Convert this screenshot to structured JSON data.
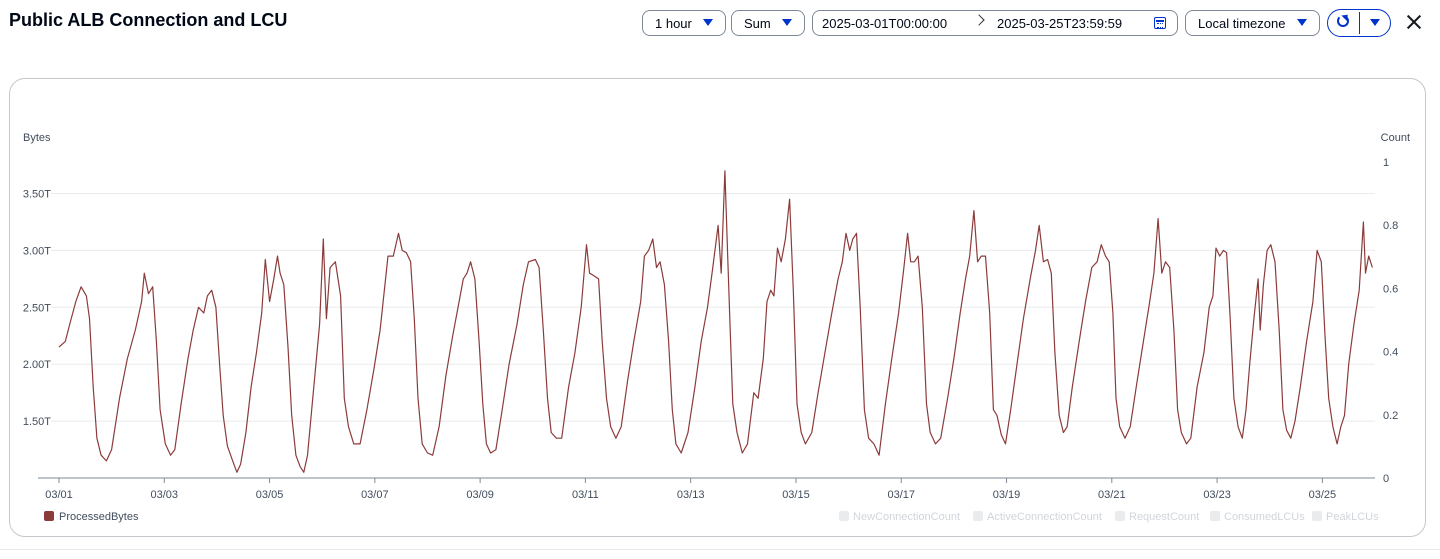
{
  "title": "Public ALB Connection and LCU",
  "controls": {
    "period": "1 hour",
    "statistic": "Sum",
    "range_start": "2025-03-01T00:00:00",
    "range_end": "2025-03-25T23:59:59",
    "timezone": "Local timezone"
  },
  "icons": [
    "caret-down-icon",
    "chevron-right-icon",
    "calendar-icon",
    "refresh-icon",
    "close-icon"
  ],
  "colors": {
    "accent": "#0033cc",
    "series": "#8c3b3b",
    "disabled": "#d1d5db"
  },
  "chart_data": {
    "type": "line",
    "ylabel": "Bytes",
    "y2label": "Count",
    "y_ticks": [
      {
        "label": "1.50T",
        "value": 1.5
      },
      {
        "label": "2.00T",
        "value": 2.0
      },
      {
        "label": "2.50T",
        "value": 2.5
      },
      {
        "label": "3.00T",
        "value": 3.0
      },
      {
        "label": "3.50T",
        "value": 3.5
      }
    ],
    "ylim": [
      1.0,
      3.9
    ],
    "y2_ticks": [
      "0",
      "0.2",
      "0.4",
      "0.6",
      "0.8",
      "1"
    ],
    "y2lim": [
      0,
      1
    ],
    "x_ticks": [
      {
        "label": "03/01",
        "day": 1
      },
      {
        "label": "03/03",
        "day": 3
      },
      {
        "label": "03/05",
        "day": 5
      },
      {
        "label": "03/07",
        "day": 7
      },
      {
        "label": "03/09",
        "day": 9
      },
      {
        "label": "03/11",
        "day": 11
      },
      {
        "label": "03/13",
        "day": 13
      },
      {
        "label": "03/15",
        "day": 15
      },
      {
        "label": "03/17",
        "day": 17
      },
      {
        "label": "03/19",
        "day": 19
      },
      {
        "label": "03/21",
        "day": 21
      },
      {
        "label": "03/23",
        "day": 23
      },
      {
        "label": "03/25",
        "day": 25
      }
    ],
    "xlim": [
      1.0,
      26.0
    ],
    "grid": true,
    "legend_position": "bottom",
    "series": [
      {
        "name": "ProcessedBytes",
        "color": "#8c3b3b",
        "points": [
          [
            1.0,
            2.15
          ],
          [
            1.12,
            2.2
          ],
          [
            1.22,
            2.38
          ],
          [
            1.32,
            2.55
          ],
          [
            1.42,
            2.68
          ],
          [
            1.52,
            2.6
          ],
          [
            1.58,
            2.4
          ],
          [
            1.65,
            1.8
          ],
          [
            1.72,
            1.35
          ],
          [
            1.8,
            1.2
          ],
          [
            1.9,
            1.15
          ],
          [
            2.0,
            1.25
          ],
          [
            2.15,
            1.7
          ],
          [
            2.3,
            2.05
          ],
          [
            2.45,
            2.3
          ],
          [
            2.57,
            2.55
          ],
          [
            2.62,
            2.8
          ],
          [
            2.7,
            2.62
          ],
          [
            2.78,
            2.68
          ],
          [
            2.85,
            2.2
          ],
          [
            2.92,
            1.6
          ],
          [
            3.02,
            1.3
          ],
          [
            3.12,
            1.2
          ],
          [
            3.2,
            1.25
          ],
          [
            3.32,
            1.65
          ],
          [
            3.45,
            2.05
          ],
          [
            3.55,
            2.3
          ],
          [
            3.65,
            2.5
          ],
          [
            3.75,
            2.45
          ],
          [
            3.82,
            2.6
          ],
          [
            3.9,
            2.65
          ],
          [
            3.98,
            2.5
          ],
          [
            4.05,
            2.0
          ],
          [
            4.12,
            1.55
          ],
          [
            4.2,
            1.28
          ],
          [
            4.3,
            1.15
          ],
          [
            4.38,
            1.05
          ],
          [
            4.45,
            1.12
          ],
          [
            4.55,
            1.4
          ],
          [
            4.65,
            1.8
          ],
          [
            4.75,
            2.1
          ],
          [
            4.85,
            2.45
          ],
          [
            4.92,
            2.92
          ],
          [
            5.0,
            2.55
          ],
          [
            5.08,
            2.75
          ],
          [
            5.15,
            2.95
          ],
          [
            5.2,
            2.8
          ],
          [
            5.27,
            2.7
          ],
          [
            5.35,
            2.15
          ],
          [
            5.42,
            1.55
          ],
          [
            5.5,
            1.2
          ],
          [
            5.58,
            1.1
          ],
          [
            5.65,
            1.05
          ],
          [
            5.72,
            1.2
          ],
          [
            5.8,
            1.6
          ],
          [
            5.88,
            2.0
          ],
          [
            5.95,
            2.35
          ],
          [
            6.02,
            3.1
          ],
          [
            6.08,
            2.4
          ],
          [
            6.15,
            2.85
          ],
          [
            6.25,
            2.9
          ],
          [
            6.35,
            2.6
          ],
          [
            6.42,
            1.7
          ],
          [
            6.5,
            1.45
          ],
          [
            6.6,
            1.3
          ],
          [
            6.72,
            1.3
          ],
          [
            6.85,
            1.6
          ],
          [
            6.98,
            1.95
          ],
          [
            7.1,
            2.3
          ],
          [
            7.25,
            2.95
          ],
          [
            7.35,
            2.95
          ],
          [
            7.45,
            3.15
          ],
          [
            7.52,
            3.0
          ],
          [
            7.6,
            2.98
          ],
          [
            7.68,
            2.9
          ],
          [
            7.75,
            2.4
          ],
          [
            7.82,
            1.7
          ],
          [
            7.9,
            1.3
          ],
          [
            8.0,
            1.22
          ],
          [
            8.1,
            1.2
          ],
          [
            8.22,
            1.45
          ],
          [
            8.35,
            1.9
          ],
          [
            8.48,
            2.25
          ],
          [
            8.6,
            2.55
          ],
          [
            8.68,
            2.75
          ],
          [
            8.75,
            2.8
          ],
          [
            8.82,
            2.9
          ],
          [
            8.9,
            2.75
          ],
          [
            8.98,
            2.2
          ],
          [
            9.05,
            1.65
          ],
          [
            9.12,
            1.3
          ],
          [
            9.2,
            1.22
          ],
          [
            9.3,
            1.25
          ],
          [
            9.42,
            1.6
          ],
          [
            9.55,
            2.0
          ],
          [
            9.7,
            2.35
          ],
          [
            9.82,
            2.7
          ],
          [
            9.92,
            2.9
          ],
          [
            10.05,
            2.92
          ],
          [
            10.12,
            2.85
          ],
          [
            10.2,
            2.3
          ],
          [
            10.28,
            1.7
          ],
          [
            10.35,
            1.4
          ],
          [
            10.45,
            1.35
          ],
          [
            10.55,
            1.35
          ],
          [
            10.68,
            1.8
          ],
          [
            10.8,
            2.1
          ],
          [
            10.92,
            2.5
          ],
          [
            11.02,
            3.05
          ],
          [
            11.08,
            2.8
          ],
          [
            11.15,
            2.78
          ],
          [
            11.25,
            2.75
          ],
          [
            11.32,
            2.2
          ],
          [
            11.4,
            1.7
          ],
          [
            11.48,
            1.45
          ],
          [
            11.58,
            1.35
          ],
          [
            11.68,
            1.45
          ],
          [
            11.8,
            1.85
          ],
          [
            11.92,
            2.2
          ],
          [
            12.05,
            2.55
          ],
          [
            12.12,
            2.95
          ],
          [
            12.2,
            3.0
          ],
          [
            12.28,
            3.1
          ],
          [
            12.35,
            2.85
          ],
          [
            12.42,
            2.9
          ],
          [
            12.5,
            2.7
          ],
          [
            12.58,
            2.2
          ],
          [
            12.65,
            1.6
          ],
          [
            12.72,
            1.3
          ],
          [
            12.82,
            1.22
          ],
          [
            12.95,
            1.4
          ],
          [
            13.08,
            1.8
          ],
          [
            13.2,
            2.2
          ],
          [
            13.32,
            2.5
          ],
          [
            13.42,
            2.85
          ],
          [
            13.52,
            3.22
          ],
          [
            13.58,
            2.8
          ],
          [
            13.65,
            3.7
          ],
          [
            13.7,
            3.0
          ],
          [
            13.75,
            2.3
          ],
          [
            13.8,
            1.65
          ],
          [
            13.88,
            1.4
          ],
          [
            13.98,
            1.22
          ],
          [
            14.08,
            1.3
          ],
          [
            14.2,
            1.75
          ],
          [
            14.28,
            1.7
          ],
          [
            14.38,
            2.05
          ],
          [
            14.45,
            2.55
          ],
          [
            14.52,
            2.65
          ],
          [
            14.58,
            2.6
          ],
          [
            14.65,
            3.02
          ],
          [
            14.72,
            2.9
          ],
          [
            14.8,
            3.1
          ],
          [
            14.88,
            3.45
          ],
          [
            14.95,
            2.65
          ],
          [
            15.02,
            1.65
          ],
          [
            15.1,
            1.4
          ],
          [
            15.18,
            1.3
          ],
          [
            15.3,
            1.4
          ],
          [
            15.42,
            1.75
          ],
          [
            15.55,
            2.1
          ],
          [
            15.68,
            2.45
          ],
          [
            15.8,
            2.75
          ],
          [
            15.88,
            2.9
          ],
          [
            15.95,
            3.15
          ],
          [
            16.02,
            3.0
          ],
          [
            16.08,
            3.1
          ],
          [
            16.15,
            3.15
          ],
          [
            16.22,
            2.5
          ],
          [
            16.3,
            1.6
          ],
          [
            16.38,
            1.35
          ],
          [
            16.48,
            1.3
          ],
          [
            16.58,
            1.2
          ],
          [
            16.7,
            1.65
          ],
          [
            16.82,
            2.05
          ],
          [
            16.95,
            2.45
          ],
          [
            17.05,
            2.85
          ],
          [
            17.12,
            3.15
          ],
          [
            17.18,
            2.9
          ],
          [
            17.25,
            2.9
          ],
          [
            17.32,
            2.95
          ],
          [
            17.4,
            2.5
          ],
          [
            17.48,
            1.65
          ],
          [
            17.55,
            1.4
          ],
          [
            17.65,
            1.3
          ],
          [
            17.75,
            1.35
          ],
          [
            17.88,
            1.7
          ],
          [
            18.0,
            2.05
          ],
          [
            18.12,
            2.45
          ],
          [
            18.22,
            2.75
          ],
          [
            18.3,
            2.95
          ],
          [
            18.38,
            3.35
          ],
          [
            18.45,
            2.9
          ],
          [
            18.52,
            2.95
          ],
          [
            18.6,
            2.95
          ],
          [
            18.68,
            2.45
          ],
          [
            18.75,
            1.6
          ],
          [
            18.82,
            1.55
          ],
          [
            18.9,
            1.38
          ],
          [
            18.98,
            1.3
          ],
          [
            19.08,
            1.6
          ],
          [
            19.2,
            2.0
          ],
          [
            19.32,
            2.4
          ],
          [
            19.45,
            2.75
          ],
          [
            19.55,
            3.0
          ],
          [
            19.62,
            3.22
          ],
          [
            19.7,
            2.9
          ],
          [
            19.78,
            2.92
          ],
          [
            19.85,
            2.8
          ],
          [
            19.92,
            2.1
          ],
          [
            20.0,
            1.55
          ],
          [
            20.08,
            1.4
          ],
          [
            20.15,
            1.45
          ],
          [
            20.25,
            1.8
          ],
          [
            20.38,
            2.2
          ],
          [
            20.5,
            2.55
          ],
          [
            20.62,
            2.85
          ],
          [
            20.72,
            2.9
          ],
          [
            20.8,
            3.05
          ],
          [
            20.88,
            2.95
          ],
          [
            20.95,
            2.9
          ],
          [
            21.02,
            2.45
          ],
          [
            21.08,
            1.7
          ],
          [
            21.15,
            1.45
          ],
          [
            21.25,
            1.35
          ],
          [
            21.35,
            1.45
          ],
          [
            21.48,
            1.85
          ],
          [
            21.6,
            2.2
          ],
          [
            21.72,
            2.55
          ],
          [
            21.8,
            2.8
          ],
          [
            21.88,
            3.28
          ],
          [
            21.95,
            2.8
          ],
          [
            22.02,
            2.9
          ],
          [
            22.1,
            2.85
          ],
          [
            22.18,
            2.3
          ],
          [
            22.25,
            1.6
          ],
          [
            22.32,
            1.4
          ],
          [
            22.42,
            1.3
          ],
          [
            22.5,
            1.35
          ],
          [
            22.62,
            1.8
          ],
          [
            22.75,
            2.1
          ],
          [
            22.85,
            2.5
          ],
          [
            22.92,
            2.6
          ],
          [
            22.98,
            3.02
          ],
          [
            23.05,
            2.95
          ],
          [
            23.12,
            3.0
          ],
          [
            23.18,
            2.98
          ],
          [
            23.25,
            2.4
          ],
          [
            23.32,
            1.7
          ],
          [
            23.4,
            1.45
          ],
          [
            23.48,
            1.35
          ],
          [
            23.55,
            1.6
          ],
          [
            23.62,
            2.0
          ],
          [
            23.7,
            2.4
          ],
          [
            23.78,
            2.75
          ],
          [
            23.82,
            2.3
          ],
          [
            23.88,
            2.7
          ],
          [
            23.95,
            3.0
          ],
          [
            24.02,
            3.05
          ],
          [
            24.1,
            2.9
          ],
          [
            24.18,
            2.3
          ],
          [
            24.25,
            1.6
          ],
          [
            24.32,
            1.42
          ],
          [
            24.4,
            1.35
          ],
          [
            24.48,
            1.5
          ],
          [
            24.58,
            1.8
          ],
          [
            24.7,
            2.2
          ],
          [
            24.82,
            2.55
          ],
          [
            24.9,
            3.0
          ],
          [
            24.98,
            2.9
          ],
          [
            25.05,
            2.25
          ],
          [
            25.12,
            1.7
          ],
          [
            25.2,
            1.45
          ],
          [
            25.28,
            1.3
          ],
          [
            25.35,
            1.45
          ],
          [
            25.42,
            1.55
          ],
          [
            25.5,
            2.0
          ],
          [
            25.6,
            2.35
          ],
          [
            25.7,
            2.65
          ],
          [
            25.78,
            3.25
          ],
          [
            25.82,
            2.8
          ],
          [
            25.88,
            2.95
          ],
          [
            25.95,
            2.85
          ]
        ]
      }
    ],
    "legend_disabled": [
      "NewConnectionCount",
      "ActiveConnectionCount",
      "RequestCount",
      "ConsumedLCUs",
      "PeakLCUs"
    ]
  }
}
